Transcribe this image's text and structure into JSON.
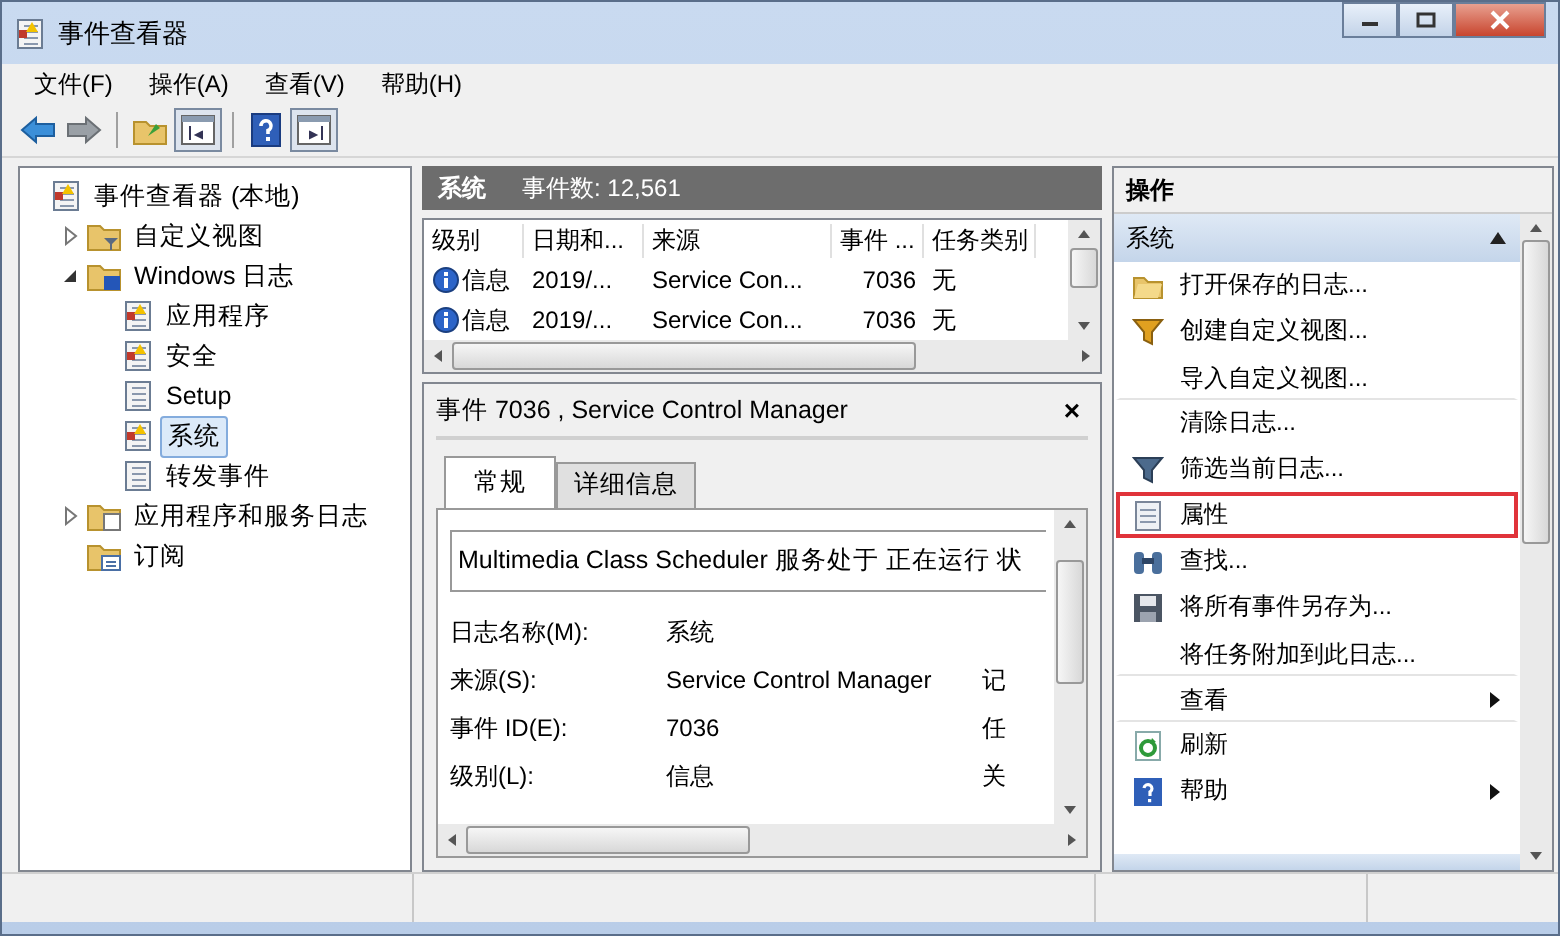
{
  "window": {
    "title": "事件查看器"
  },
  "menu": [
    "文件(F)",
    "操作(A)",
    "查看(V)",
    "帮助(H)"
  ],
  "toolbar": [
    {
      "kind": "back",
      "disabled": false
    },
    {
      "kind": "forward",
      "disabled": true
    },
    {
      "kind": "separator"
    },
    {
      "kind": "up"
    },
    {
      "kind": "tree-toggle",
      "on": true
    },
    {
      "kind": "separator"
    },
    {
      "kind": "help"
    },
    {
      "kind": "action-toggle",
      "on": true
    }
  ],
  "tree": [
    {
      "label": "事件查看器 (本地)",
      "kind": "log",
      "selected": false,
      "children": [
        {
          "label": "自定义视图",
          "kind": "folder-filter",
          "expanded": false,
          "selected": false
        },
        {
          "label": "Windows 日志",
          "kind": "folder-windows",
          "expanded": true,
          "selected": false,
          "children": [
            {
              "label": "应用程序",
              "kind": "log",
              "selected": false
            },
            {
              "label": "安全",
              "kind": "log",
              "selected": false
            },
            {
              "label": "Setup",
              "kind": "log-plain",
              "selected": false
            },
            {
              "label": "系统",
              "kind": "log",
              "selected": true
            },
            {
              "label": "转发事件",
              "kind": "log-plain",
              "selected": false
            }
          ]
        },
        {
          "label": "应用程序和服务日志",
          "kind": "folder-doc",
          "expanded": false,
          "selected": false
        },
        {
          "label": "订阅",
          "kind": "folder-calendar",
          "selected": false
        }
      ]
    }
  ],
  "log_header": {
    "title": "系统",
    "count": "事件数: 12,561"
  },
  "events": {
    "columns": [
      "级别",
      "日期和...",
      "来源",
      "事件 ...",
      "任务类别"
    ],
    "rows": [
      {
        "level": "信息",
        "date": "2019/...",
        "source": "Service Con...",
        "id": "7036",
        "category": "无",
        "selected": false
      },
      {
        "level": "信息",
        "date": "2019/...",
        "source": "Service Con...",
        "id": "7036",
        "category": "无",
        "selected": false
      }
    ]
  },
  "detail": {
    "title": "事件 7036 , Service Control Manager",
    "close": "×",
    "tabs": [
      {
        "label": "常规",
        "selected": true
      },
      {
        "label": "详细信息",
        "selected": false
      }
    ],
    "description": "Multimedia Class Scheduler 服务处于 正在运行 状",
    "fields": [
      {
        "label": "日志名称(M):",
        "value": "系统"
      },
      {
        "label": "来源(S):",
        "value": "Service Control Manager",
        "extra": "记"
      },
      {
        "label": "事件 ID(E):",
        "value": "7036",
        "extra": "任"
      },
      {
        "label": "级别(L):",
        "value": "信息",
        "extra": "关"
      }
    ]
  },
  "actions": {
    "title": "操作",
    "section": {
      "label": "系统",
      "expanded": true
    },
    "items": [
      {
        "label": "打开保存的日志...",
        "kind": "open",
        "highlighted": false,
        "divider": false,
        "submenu": false
      },
      {
        "label": "创建自定义视图...",
        "kind": "filter-color",
        "highlighted": false,
        "divider": false,
        "submenu": false
      },
      {
        "label": "导入自定义视图...",
        "kind": "none",
        "highlighted": false,
        "divider": true,
        "submenu": false
      },
      {
        "label": "清除日志...",
        "kind": "none",
        "highlighted": false,
        "divider": false,
        "submenu": false
      },
      {
        "label": "筛选当前日志...",
        "kind": "filter",
        "highlighted": false,
        "divider": false,
        "submenu": false
      },
      {
        "label": "属性",
        "kind": "properties",
        "highlighted": true,
        "divider": false,
        "submenu": false
      },
      {
        "label": "查找...",
        "kind": "find",
        "highlighted": false,
        "divider": false,
        "submenu": false
      },
      {
        "label": "将所有事件另存为...",
        "kind": "save",
        "highlighted": false,
        "divider": false,
        "submenu": false
      },
      {
        "label": "将任务附加到此日志...",
        "kind": "none",
        "highlighted": false,
        "divider": true,
        "submenu": false
      },
      {
        "label": "查看",
        "kind": "none",
        "highlighted": false,
        "divider": true,
        "submenu": true
      },
      {
        "label": "刷新",
        "kind": "refresh",
        "highlighted": false,
        "divider": false,
        "submenu": false
      },
      {
        "label": "帮助",
        "kind": "help",
        "highlighted": false,
        "divider": false,
        "submenu": true
      }
    ]
  }
}
